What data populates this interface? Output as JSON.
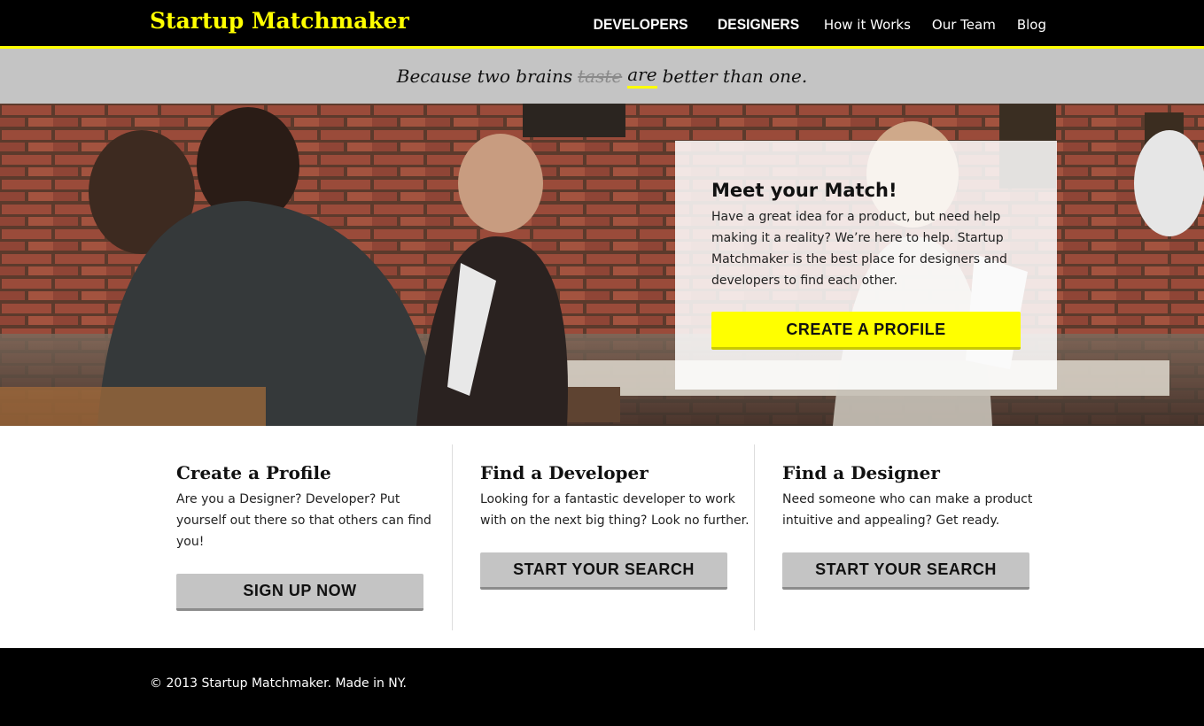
{
  "nav": {
    "brand": "Startup Matchmaker",
    "links": [
      "DEVELOPERS",
      "DESIGNERS",
      "How it Works",
      "Our Team",
      "Blog"
    ]
  },
  "tagline": {
    "before": "Because two brains",
    "struck": "taste",
    "underlined": "are",
    "after": "better than one."
  },
  "hero": {
    "title": "Meet your Match!",
    "body": "Have a great idea for a product, but need help making it a reality? We’re here to help. Startup Matchmaker is the best place for designers and developers to find each other.",
    "cta": "CREATE A PROFILE"
  },
  "features": [
    {
      "title": "Create a Profile",
      "body": "Are you a Designer? Developer? Put yourself out there so that others can find you!",
      "button": "SIGN UP NOW"
    },
    {
      "title": "Find a Developer",
      "body": "Looking for a fantastic developer to work with on the next big thing? Look no further.",
      "button": "START YOUR SEARCH"
    },
    {
      "title": "Find a Designer",
      "body": "Need someone who can make a product intuitive and appealing? Get ready.",
      "button": "START YOUR SEARCH"
    }
  ],
  "footer": {
    "text": "© 2013 Startup Matchmaker. Made in NY."
  },
  "colors": {
    "accent": "#ffff00",
    "nav_bg": "#000000",
    "band_gray": "#c4c4c4"
  }
}
